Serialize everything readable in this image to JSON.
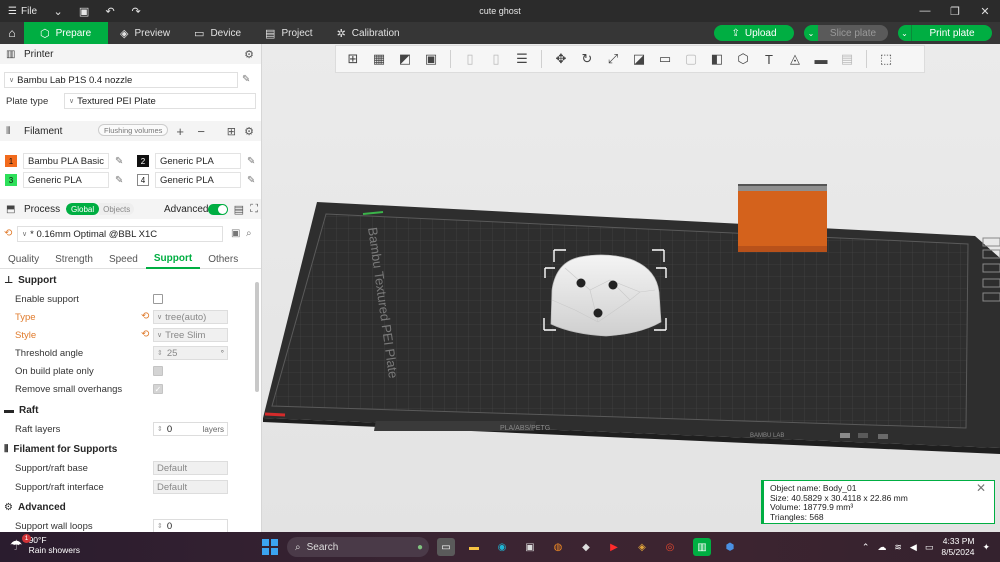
{
  "titlebar": {
    "file_label": "File",
    "title": "cute ghost"
  },
  "maintoolbar": {
    "tabs": [
      "Prepare",
      "Preview",
      "Device",
      "Project",
      "Calibration"
    ],
    "upload_label": "Upload",
    "slice_label": "Slice plate",
    "print_label": "Print plate"
  },
  "printer": {
    "section_title": "Printer",
    "name": "Bambu Lab P1S 0.4 nozzle",
    "plate_type_label": "Plate type",
    "plate_type_value": "Textured PEI Plate"
  },
  "filament": {
    "section_title": "Filament",
    "flushing_label": "Flushing volumes",
    "items": [
      {
        "num": "1",
        "name": "Bambu PLA Basic",
        "color": "#f26b1d"
      },
      {
        "num": "2",
        "name": "Generic PLA",
        "color": "#111111"
      },
      {
        "num": "3",
        "name": "Generic PLA",
        "color": "#2ee05a"
      },
      {
        "num": "4",
        "name": "Generic PLA",
        "color": "#ffffff"
      }
    ]
  },
  "process": {
    "section_title": "Process",
    "global_label": "Global",
    "objects_label": "Objects",
    "advanced_label": "Advanced",
    "preset": "* 0.16mm Optimal @BBL X1C",
    "subtabs": [
      "Quality",
      "Strength",
      "Speed",
      "Support",
      "Others"
    ],
    "active_subtab": "Support"
  },
  "support": {
    "group_support": "Support",
    "enable_support": "Enable support",
    "type_label": "Type",
    "type_value": "tree(auto)",
    "style_label": "Style",
    "style_value": "Tree Slim",
    "threshold_label": "Threshold angle",
    "threshold_value": "25",
    "threshold_unit": "°",
    "build_plate_only": "On build plate only",
    "remove_small": "Remove small overhangs",
    "group_raft": "Raft",
    "raft_layers_label": "Raft layers",
    "raft_layers_value": "0",
    "raft_layers_unit": "layers",
    "group_filament": "Filament for Supports",
    "support_base_label": "Support/raft base",
    "support_base_value": "Default",
    "support_interface_label": "Support/raft interface",
    "support_interface_value": "Default",
    "group_advanced": "Advanced",
    "wall_loops_label": "Support wall loops",
    "wall_loops_value": "0"
  },
  "plate": {
    "brand_text": "Bambu Textured PEI Plate",
    "front_label": "PLA/ABS/PETG",
    "front_brand": "BAMBU LAB"
  },
  "object_info": {
    "name": "Object name: Body_01",
    "size": "Size: 40.5829 x 30.4118 x 22.86 mm",
    "volume": "Volume: 18779.9 mm³",
    "triangles": "Triangles: 568"
  },
  "taskbar": {
    "weather_badge": "1",
    "temperature": "90°F",
    "condition": "Rain showers",
    "search_placeholder": "Search",
    "time": "4:33 PM",
    "date": "8/5/2024"
  }
}
